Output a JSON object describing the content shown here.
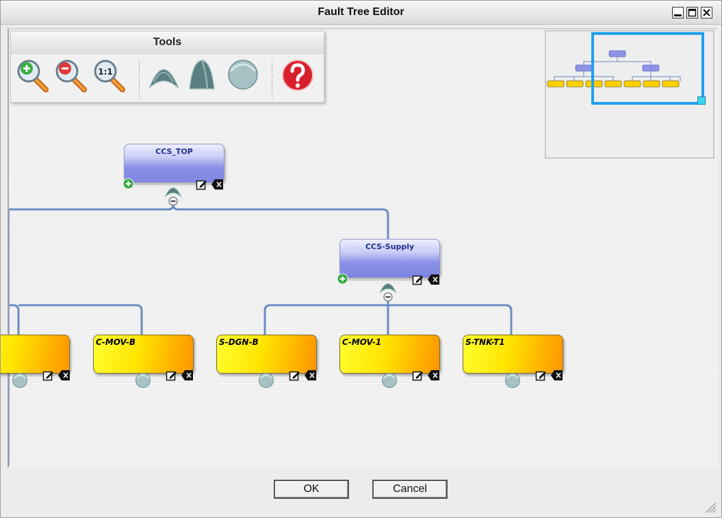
{
  "window": {
    "title": "Fault Tree Editor",
    "controls": [
      "minimize-icon",
      "maximize-icon",
      "close-icon"
    ]
  },
  "tools": {
    "title": "Tools",
    "items": [
      {
        "name": "zoom-in-icon"
      },
      {
        "name": "zoom-out-icon"
      },
      {
        "name": "zoom-actual-size-icon",
        "label": "1:1"
      },
      {
        "name": "or-gate-icon"
      },
      {
        "name": "and-gate-icon"
      },
      {
        "name": "basic-event-icon"
      },
      {
        "name": "help-icon"
      }
    ]
  },
  "tree": {
    "gates": [
      {
        "label": "CCS_TOP"
      },
      {
        "label": "CCS-Supply"
      }
    ],
    "events": [
      {
        "label": "C-MOV-B"
      },
      {
        "label": "S-DGN-B"
      },
      {
        "label": "C-MOV-1"
      },
      {
        "label": "S-TNK-T1"
      }
    ]
  },
  "buttons": {
    "ok": "OK",
    "cancel": "Cancel"
  },
  "colors": {
    "gate_fill": "#8c92e6",
    "event_fill": "#ffd000",
    "connector": "#6a8cc0",
    "viewport": "#1ea0f0"
  }
}
